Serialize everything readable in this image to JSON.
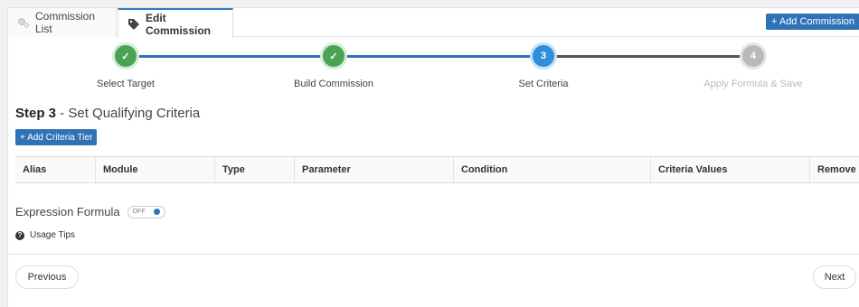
{
  "tabs": {
    "commission_list": "Commission List",
    "edit_commission": "Edit Commission"
  },
  "add_commission_label": "+ Add Commission",
  "wizard": {
    "steps": [
      {
        "number": "✓",
        "label": "Select Target",
        "state": "done"
      },
      {
        "number": "✓",
        "label": "Build Commission",
        "state": "done"
      },
      {
        "number": "3",
        "label": "Set Criteria",
        "state": "current"
      },
      {
        "number": "4",
        "label": "Apply Formula & Save",
        "state": "todo"
      }
    ]
  },
  "step_heading": {
    "step": "Step 3",
    "title": " - Set Qualifying Criteria"
  },
  "add_criteria_tier_label": "+ Add Criteria Tier",
  "criteria_table": {
    "columns": [
      "Alias",
      "Module",
      "Type",
      "Parameter",
      "Condition",
      "Criteria Values",
      "Remove"
    ]
  },
  "expression_formula": {
    "label": "Expression Formula",
    "toggle_state": "OFF"
  },
  "usage_tips_label": "Usage Tips",
  "buttons": {
    "previous": "Previous",
    "next": "Next"
  },
  "colors": {
    "primary": "#2f73b6",
    "done": "#4aa356",
    "current": "#2f8fd8",
    "todo": "#b9b9b9"
  }
}
